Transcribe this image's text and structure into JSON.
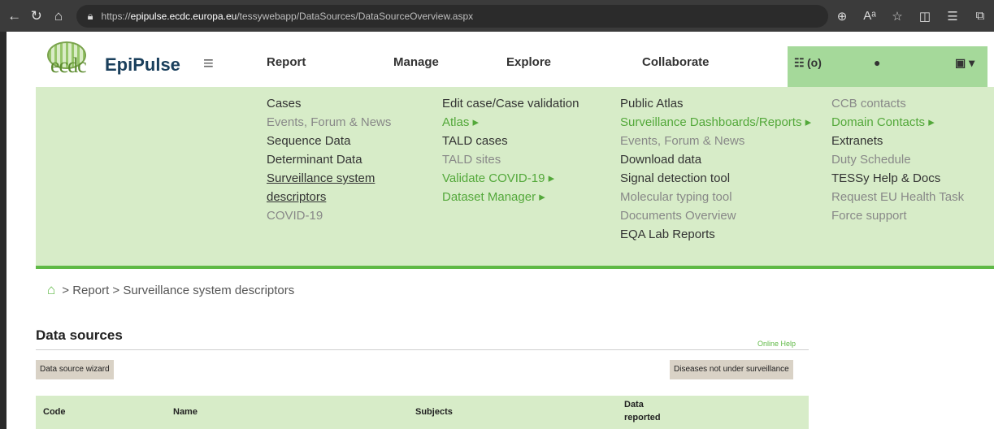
{
  "browser": {
    "url_prefix": "https://",
    "url_host": "epipulse.ecdc.europa.eu",
    "url_path": "/tessywebapp/DataSources/DataSourceOverview.aspx"
  },
  "header": {
    "logo_text": "ecdc",
    "brand": "EpiPulse",
    "nav": [
      "Report",
      "Manage",
      "Explore",
      "Collaborate"
    ],
    "list_count": "(o)"
  },
  "menu": {
    "report": [
      {
        "label": "Cases",
        "style": "dark"
      },
      {
        "label": "Events, Forum & News",
        "style": "gray"
      },
      {
        "label": "Sequence Data",
        "style": "dark"
      },
      {
        "label": "Determinant Data",
        "style": "dark"
      },
      {
        "label": "Surveillance system",
        "style": "u"
      },
      {
        "label": "descriptors",
        "style": "u"
      },
      {
        "label": "COVID-19",
        "style": "gray"
      }
    ],
    "manage": [
      {
        "label": "Edit case/Case validation",
        "style": "dark"
      },
      {
        "label": "Atlas ▸",
        "style": "green"
      },
      {
        "label": "TALD cases",
        "style": "dark"
      },
      {
        "label": "TALD sites",
        "style": "gray"
      },
      {
        "label": "Validate COVID-19 ▸",
        "style": "green"
      },
      {
        "label": "Dataset Manager ▸",
        "style": "green"
      }
    ],
    "explore": [
      {
        "label": "Public Atlas",
        "style": "dark"
      },
      {
        "label": "Surveillance Dashboards/Reports ▸",
        "style": "green"
      },
      {
        "label": "Events, Forum & News",
        "style": "gray"
      },
      {
        "label": "Download data",
        "style": "dark"
      },
      {
        "label": "Signal detection tool",
        "style": "dark"
      },
      {
        "label": "Molecular typing tool",
        "style": "gray"
      },
      {
        "label": "Documents Overview",
        "style": "gray"
      },
      {
        "label": "EQA Lab Reports",
        "style": "dark"
      }
    ],
    "collaborate": [
      {
        "label": "CCB contacts",
        "style": "gray"
      },
      {
        "label": "Domain Contacts ▸",
        "style": "green"
      },
      {
        "label": "Extranets",
        "style": "dark"
      },
      {
        "label": "Duty Schedule",
        "style": "gray"
      },
      {
        "label": "TESSy Help & Docs",
        "style": "dark"
      },
      {
        "label": "Request EU Health Task",
        "style": "gray"
      },
      {
        "label": "Force support",
        "style": "gray"
      }
    ]
  },
  "breadcrumb": {
    "sep": ">",
    "path": "Report > Surveillance system descriptors"
  },
  "datasources": {
    "title": "Data sources",
    "online_help": "Online Help",
    "wizard_button": "Data source wizard",
    "diseases_button": "Diseases not under surveillance",
    "columns": [
      "Code",
      "Name",
      "Subjects",
      "Data",
      "reported"
    ]
  }
}
